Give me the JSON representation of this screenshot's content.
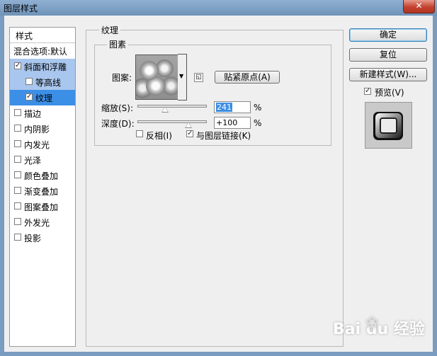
{
  "window": {
    "title": "图层样式",
    "close_glyph": "✕"
  },
  "styles_panel": {
    "header": "样式",
    "items": [
      {
        "label": "混合选项:默认",
        "checkbox": false,
        "checked": false,
        "selected": ""
      },
      {
        "label": "斜面和浮雕",
        "checkbox": true,
        "checked": true,
        "selected": "a"
      },
      {
        "label": "等高线",
        "checkbox": true,
        "checked": false,
        "selected": "a",
        "indent": true
      },
      {
        "label": "纹理",
        "checkbox": true,
        "checked": true,
        "selected": "b",
        "indent": true
      },
      {
        "label": "描边",
        "checkbox": true,
        "checked": false
      },
      {
        "label": "内阴影",
        "checkbox": true,
        "checked": false
      },
      {
        "label": "内发光",
        "checkbox": true,
        "checked": false
      },
      {
        "label": "光泽",
        "checkbox": true,
        "checked": false
      },
      {
        "label": "颜色叠加",
        "checkbox": true,
        "checked": false
      },
      {
        "label": "渐变叠加",
        "checkbox": true,
        "checked": false
      },
      {
        "label": "图案叠加",
        "checkbox": true,
        "checked": false
      },
      {
        "label": "外发光",
        "checkbox": true,
        "checked": false
      },
      {
        "label": "投影",
        "checkbox": true,
        "checked": false
      }
    ]
  },
  "texture": {
    "group_title": "纹理",
    "elements_title": "图素",
    "pattern_label": "图案:",
    "snap_button": "贴紧原点(A)",
    "scale_label": "缩放(S):",
    "scale_value": "241",
    "scale_percent": 40,
    "depth_label": "深度(D):",
    "depth_value": "+100",
    "depth_percent": 73,
    "percent_unit": "%",
    "invert_label": "反相(I)",
    "invert_checked": false,
    "link_label": "与图层链接(K)",
    "link_checked": true
  },
  "buttons": {
    "ok": "确定",
    "reset": "复位",
    "new_style": "新建样式(W)...",
    "preview_label": "预览(V)",
    "preview_checked": true
  },
  "check_glyph": "✓",
  "watermark": "Bai du 经验"
}
